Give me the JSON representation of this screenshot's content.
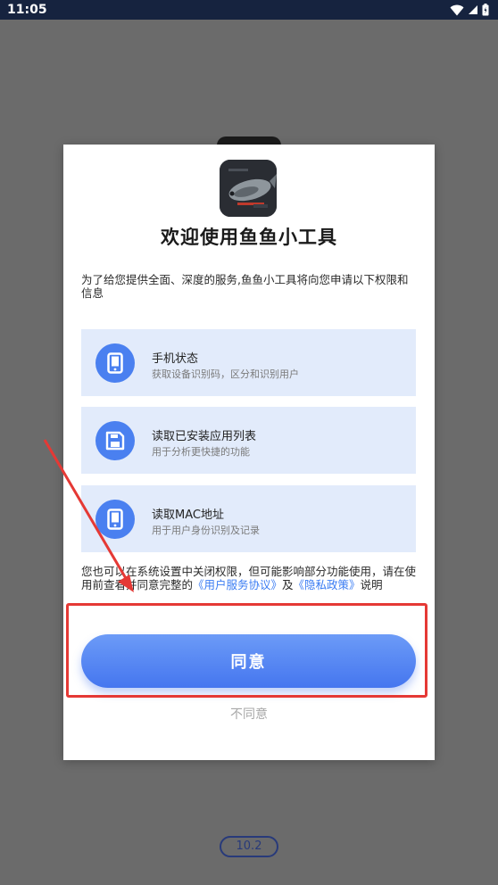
{
  "status_bar": {
    "time": "11:05",
    "icons": [
      "wifi-icon",
      "cellular-signal-icon",
      "battery-icon"
    ]
  },
  "dialog": {
    "title": "欢迎使用鱼鱼小工具",
    "intro": "为了给您提供全面、深度的服务,鱼鱼小工具将向您申请以下权限和信息",
    "permissions": [
      {
        "icon": "phone-icon",
        "name": "手机状态",
        "desc": "获取设备识别码，区分和识别用户"
      },
      {
        "icon": "save-icon",
        "name": "读取已安装应用列表",
        "desc": "用于分析更快捷的功能"
      },
      {
        "icon": "phone-icon",
        "name": "读取MAC地址",
        "desc": "用于用户身份识别及记录"
      }
    ],
    "notice_prefix": "您也可以在系统设置中关闭权限，但可能影响部分功能使用，请在使用前查看并同意完整的",
    "user_agreement_link": "《用户服务协议》",
    "notice_and": "及",
    "privacy_link": "《隐私政策》",
    "notice_suffix": "说明",
    "agree_label": "同意",
    "disagree_label": "不同意"
  },
  "version": "10.2",
  "colors": {
    "accent": "#4A80F0",
    "card_bg": "#E2EBFB",
    "link": "#3A7CF3",
    "annotation_red": "#E53935",
    "status_bar_bg": "#16233F"
  }
}
